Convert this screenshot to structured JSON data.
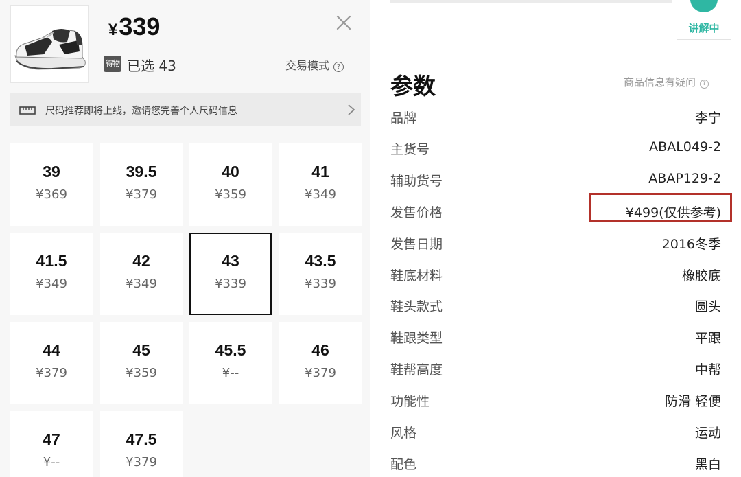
{
  "left": {
    "price": {
      "symbol": "¥",
      "amount": "339"
    },
    "selected_tag": "得物",
    "selected_text": "已选 43",
    "trade_mode": "交易模式",
    "banner_text": "尺码推荐即将上线，邀请您完善个人尺码信息",
    "sizes": [
      {
        "size": "39",
        "price": "¥369"
      },
      {
        "size": "39.5",
        "price": "¥379"
      },
      {
        "size": "40",
        "price": "¥359"
      },
      {
        "size": "41",
        "price": "¥349"
      },
      {
        "size": "41.5",
        "price": "¥349"
      },
      {
        "size": "42",
        "price": "¥349"
      },
      {
        "size": "43",
        "price": "¥339",
        "selected": true
      },
      {
        "size": "43.5",
        "price": "¥339"
      },
      {
        "size": "44",
        "price": "¥379"
      },
      {
        "size": "45",
        "price": "¥359"
      },
      {
        "size": "45.5",
        "price": "¥--"
      },
      {
        "size": "46",
        "price": "¥379"
      },
      {
        "size": "47",
        "price": "¥--"
      },
      {
        "size": "47.5",
        "price": "¥379"
      }
    ]
  },
  "right": {
    "explain_label": "讲解中",
    "title": "参数",
    "doubt_link": "商品信息有疑问",
    "params": [
      {
        "key": "品牌",
        "value": "李宁"
      },
      {
        "key": "主货号",
        "value": "ABAL049-2"
      },
      {
        "key": "辅助货号",
        "value": "ABAP129-2"
      },
      {
        "key": "发售价格",
        "value": "¥499(仅供参考)"
      },
      {
        "key": "发售日期",
        "value": "2016冬季"
      },
      {
        "key": "鞋底材料",
        "value": "橡胶底"
      },
      {
        "key": "鞋头款式",
        "value": "圆头"
      },
      {
        "key": "鞋跟类型",
        "value": "平跟"
      },
      {
        "key": "鞋帮高度",
        "value": "中帮"
      },
      {
        "key": "功能性",
        "value": "防滑  轻便"
      },
      {
        "key": "风格",
        "value": "运动"
      },
      {
        "key": "配色",
        "value": "黑白"
      }
    ]
  },
  "colors": {
    "accent": "#2fb7a3",
    "highlight_border": "#b3312a",
    "selected_border": "#111111"
  }
}
